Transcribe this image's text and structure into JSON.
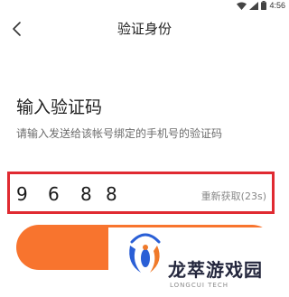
{
  "status_bar": {
    "time": "4:56"
  },
  "header": {
    "title": "验证身份"
  },
  "content": {
    "heading": "输入验证码",
    "subtitle": "请输入发送给该帐号绑定的手机号的验证码"
  },
  "code_input": {
    "digits": [
      "9",
      "6",
      "8",
      "8"
    ],
    "resend_label": "重新获取(23s)"
  },
  "watermark": {
    "name": "龙萃游戏园",
    "subtitle": "LONGCUI TECH"
  },
  "colors": {
    "accent": "#f8742e",
    "highlight_border": "#e02a31",
    "logo_blue": "#2a5fd6",
    "logo_orange": "#f07a2a"
  }
}
